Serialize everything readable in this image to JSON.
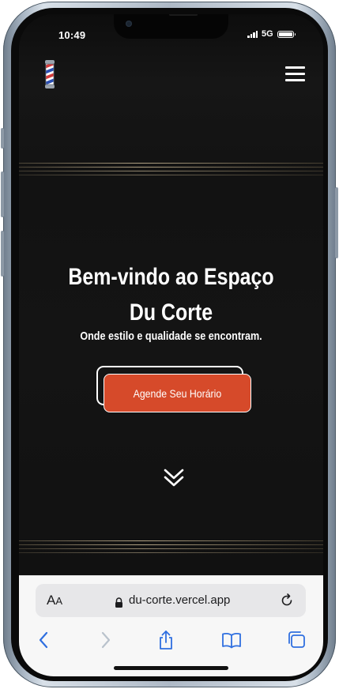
{
  "status_bar": {
    "time": "10:49",
    "network": "5G"
  },
  "header": {
    "logo_icon": "barber-pole-icon",
    "menu_icon": "hamburger-menu-icon"
  },
  "hero": {
    "title": "Bem-vindo ao Espaço Du Corte",
    "subtitle": "Onde estilo e qualidade se encontram.",
    "cta_label": "Agende Seu Horário",
    "scroll_icon": "double-chevron-down-icon"
  },
  "browser": {
    "text_size_label_big": "A",
    "text_size_label_small": "A",
    "url": "du-corte.vercel.app",
    "toolbar": [
      "back-icon",
      "forward-icon",
      "share-icon",
      "bookmarks-icon",
      "tabs-icon"
    ]
  },
  "colors": {
    "background": "#121212",
    "accent": "#d64a2a",
    "text": "#ffffff",
    "browser_tint": "#2f6fe0"
  }
}
